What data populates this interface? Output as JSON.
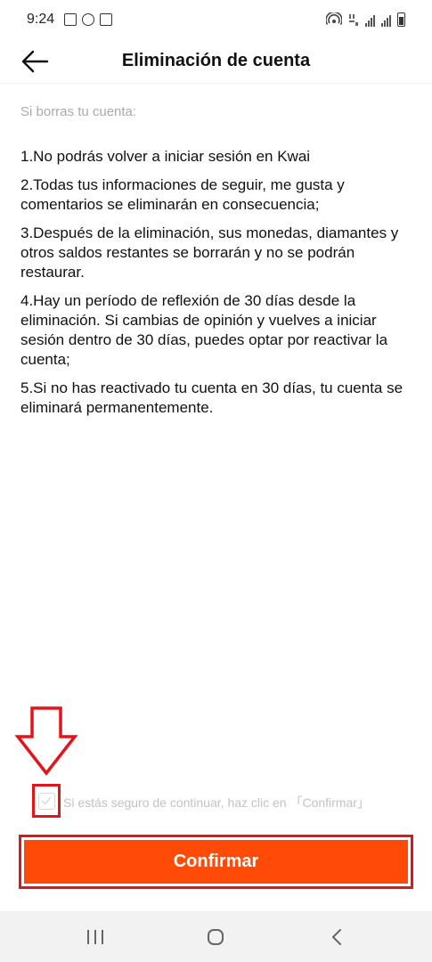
{
  "status_bar": {
    "time": "9:24",
    "left_icons": [
      "image-icon",
      "whatsapp-icon",
      "app-icon"
    ],
    "right_icons": [
      "hotspot-icon",
      "network-icon",
      "signal-icon",
      "signal-icon",
      "battery-icon"
    ]
  },
  "header": {
    "title": "Eliminación de cuenta",
    "back_icon": "arrow-left-icon"
  },
  "content": {
    "intro": "Si borras tu cuenta:",
    "rules": [
      "1.No podrás volver a iniciar sesión en Kwai",
      "2.Todas tus informaciones de seguir, me gusta y comentarios se eliminarán en consecuencia;",
      "3.Después de la eliminación, sus monedas, diamantes y otros saldos restantes se borrarán y no se podrán restaurar.",
      "4.Hay un período de reflexión de 30 días desde la eliminación. Si cambias de opinión y vuelves a iniciar sesión dentro de 30 días, puedes optar por reactivar la cuenta;",
      "5.Si no has reactivado tu cuenta en 30 días, tu cuenta se eliminará permanentemente."
    ]
  },
  "consent": {
    "text": "Si estás seguro de continuar, haz clic en 「Confirmar」",
    "checked": false
  },
  "confirm_button": {
    "label": "Confirmar"
  },
  "colors": {
    "accent": "#ff4a08",
    "annotation": "#e4141b",
    "muted_text": "#c2c2c2"
  },
  "nav_bar": {
    "icons": [
      "recents-icon",
      "home-icon",
      "back-icon"
    ]
  }
}
